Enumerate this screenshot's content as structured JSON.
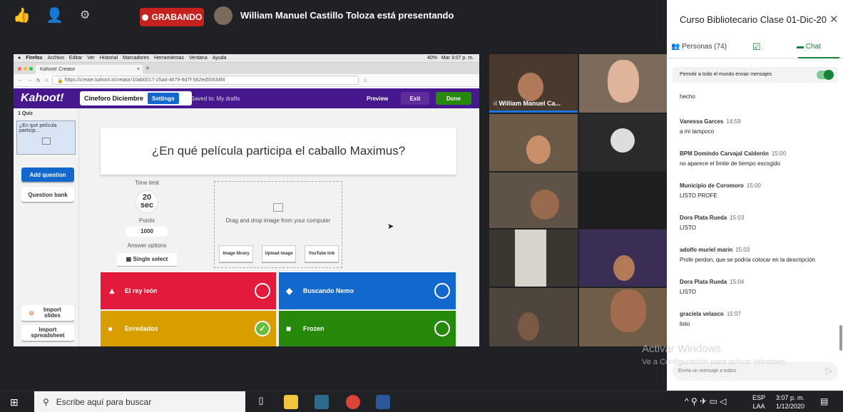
{
  "meet": {
    "recording_label": "GRABANDO",
    "presenting_text": "William Manuel Castillo Toloza está presentando",
    "icons": [
      "thumbs-up-icon",
      "avatar-icon",
      "settings-icon"
    ]
  },
  "browser": {
    "menu": [
      "Firefox",
      "Archivo",
      "Editar",
      "Ver",
      "Historial",
      "Marcadores",
      "Herramientas",
      "Ventana",
      "Ayuda"
    ],
    "clock": "Mar 3:07 p. m.",
    "battery": "40%",
    "tab_label": "Kahoot! Creator",
    "url": "https://create.kahoot.it/creator/10ab0017-25ad-4679-8d7f-562ed55634f4"
  },
  "kahoot": {
    "logo": "Kahoot!",
    "title": "Cineforo Diciembre",
    "settings": "Settings",
    "saved": "Saved to: My drafts",
    "preview": "Preview",
    "exit": "Exit",
    "done": "Done",
    "quiz_label": "1 Quiz",
    "quiz_preview": "¿En qué película particip...",
    "add_question": "Add question",
    "question_bank": "Question bank",
    "import_slides": "Import slides",
    "import_spreadsheet": "Import spreadsheet",
    "question": "¿En qué película participa el caballo Maximus?",
    "time_limit_label": "Time limit",
    "time_value": "20",
    "time_unit": "sec",
    "points_label": "Points",
    "points_value": "1000",
    "answer_options_label": "Answer options",
    "answer_type": "Single select",
    "drag_drop": "Drag and drop image from your computer",
    "image_library": "Image library",
    "upload_image": "Upload image",
    "youtube_link": "YouTube link",
    "answers": [
      {
        "label": "El rey león",
        "color": "#e21b3c",
        "symbol": "▲",
        "correct": false
      },
      {
        "label": "Buscando Nemo",
        "color": "#1368ce",
        "symbol": "◆",
        "correct": false
      },
      {
        "label": "Enredados",
        "color": "#d89e00",
        "symbol": "●",
        "correct": true
      },
      {
        "label": "Frozen",
        "color": "#26890c",
        "symbol": "■",
        "correct": false
      }
    ]
  },
  "video": {
    "speaker_name": "William Manuel Ca..."
  },
  "panel": {
    "title": "Curso Bibliotecario Clase 01-Dic-20",
    "people_tab": "Personas (74)",
    "chat_tab": "Chat",
    "permit_label": "Permitir a todo el mundo enviar mensajes",
    "permit_on": true,
    "first_message": "hecho",
    "messages": [
      {
        "author": "Vanessa Garces",
        "time": "14:59",
        "text": "a mi tampoco"
      },
      {
        "author": "BPM Domindo Carvajal Calderón",
        "time": "15:00",
        "text": "no aparece el limite de tiempo escogido"
      },
      {
        "author": "Municipio de Coromoro",
        "time": "15:00",
        "text": "LISTO PROFE"
      },
      {
        "author": "Dora Plata Rueda",
        "time": "15:03",
        "text": "LISTO"
      },
      {
        "author": "adolfo muriel marin",
        "time": "15:03",
        "text": "Profe perdon, que se podría colocar en la descripción"
      },
      {
        "author": "Dora Plata Rueda",
        "time": "15:04",
        "text": "LISTO"
      },
      {
        "author": "graciela velasco",
        "time": "15:07",
        "text": "listo"
      }
    ],
    "input_placeholder": "Envía un mensaje a todos"
  },
  "watermark": {
    "line1": "Activar Windows",
    "line2": "Ve a Configuración para activar Windows."
  },
  "taskbar": {
    "search_placeholder": "Escribe aquí para buscar",
    "lang1": "ESP",
    "lang2": "LAA",
    "time": "3:07 p. m.",
    "date": "1/12/2020"
  }
}
